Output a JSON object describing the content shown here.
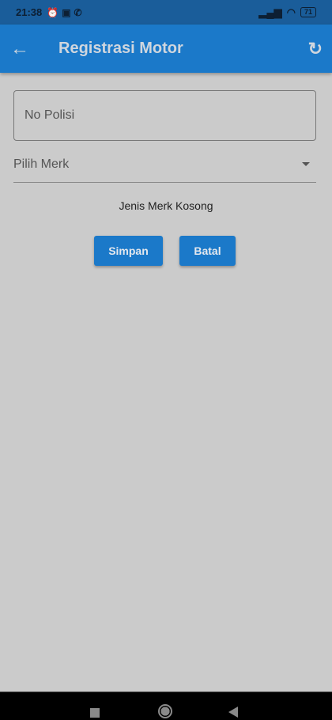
{
  "status_bar": {
    "time": "21:38",
    "icons": [
      "alarm-icon",
      "cast-icon",
      "call-icon"
    ],
    "battery": "71"
  },
  "app_bar": {
    "title": "Registrasi Motor",
    "back_icon": "arrow-left-icon",
    "refresh_icon": "refresh-icon"
  },
  "form": {
    "no_polisi_label": "No Polisi",
    "merk_placeholder": "Pilih Merk",
    "message": "Jenis Merk Kosong"
  },
  "buttons": {
    "save": "Simpan",
    "cancel": "Batal"
  },
  "colors": {
    "primary": "#1b79c9",
    "status_bar": "#1a5d9a",
    "background": "#cbcbcb"
  }
}
